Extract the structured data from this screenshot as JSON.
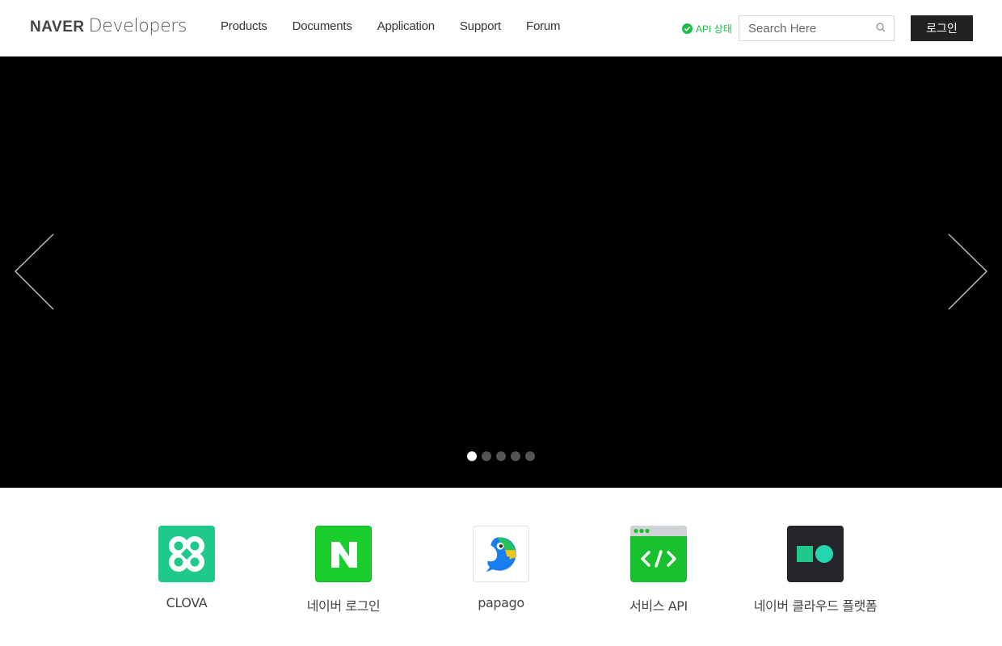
{
  "header": {
    "logo_brand": "NAVER",
    "logo_sub": "Developers",
    "nav": [
      "Products",
      "Documents",
      "Application",
      "Support",
      "Forum"
    ],
    "api_status": "API 상태",
    "search_placeholder": "Search Here",
    "login_label": "로그인"
  },
  "hero": {
    "slide_count": 5,
    "active_slide": 1
  },
  "products": [
    {
      "name": "CLOVA",
      "icon": "clova-icon",
      "color": "#1ec98a"
    },
    {
      "name": "네이버 로그인",
      "icon": "naver-login-icon",
      "color": "#19ce2a"
    },
    {
      "name": "papago",
      "icon": "papago-icon",
      "color": "#ffffff"
    },
    {
      "name": "서비스 API",
      "icon": "service-api-icon",
      "color": "#19c02e"
    },
    {
      "name": "네이버 클라우드 플랫폼",
      "icon": "ncp-icon",
      "color": "#23252b"
    }
  ],
  "colors": {
    "accent_green": "#1fba4c",
    "hero_bg": "#000000",
    "login_bg": "#222222"
  }
}
